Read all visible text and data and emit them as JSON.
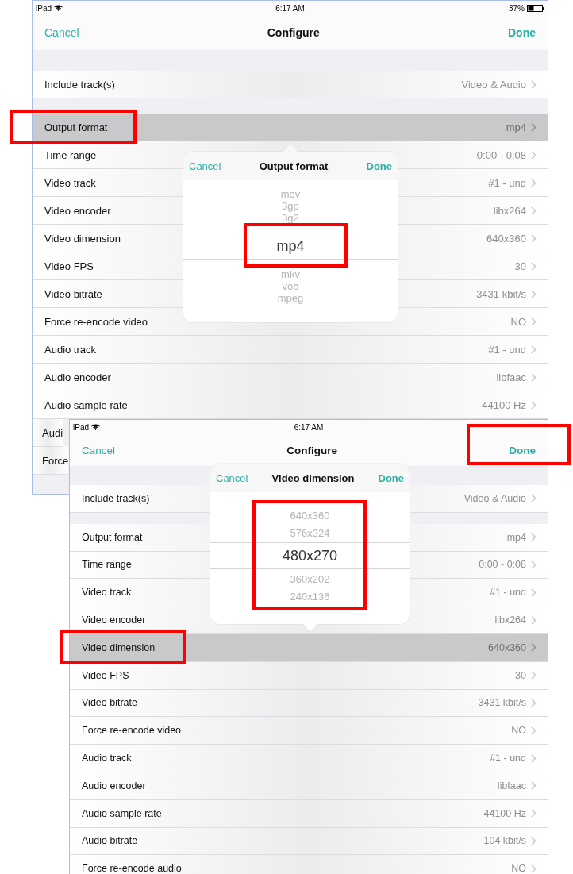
{
  "screens": [
    {
      "status_bar": {
        "carrier": "iPad",
        "time": "6:17 AM",
        "battery": "37%"
      },
      "nav": {
        "cancel": "Cancel",
        "title": "Configure",
        "done": "Done"
      },
      "groups": [
        [
          {
            "label": "Include track(s)",
            "value": "Video & Audio",
            "selected": false
          }
        ],
        [
          {
            "label": "Output format",
            "value": "mp4",
            "selected": true
          },
          {
            "label": "Time range",
            "value": "0:00 - 0:08",
            "selected": false
          },
          {
            "label": "Video track",
            "value": "#1 - und",
            "selected": false
          },
          {
            "label": "Video encoder",
            "value": "libx264",
            "selected": false
          },
          {
            "label": "Video dimension",
            "value": "640x360",
            "selected": false
          },
          {
            "label": "Video FPS",
            "value": "30",
            "selected": false
          },
          {
            "label": "Video bitrate",
            "value": "3431 kbit/s",
            "selected": false
          },
          {
            "label": "Force re-encode video",
            "value": "NO",
            "selected": false
          },
          {
            "label": "Audio track",
            "value": "#1 - und",
            "selected": false
          },
          {
            "label": "Audio encoder",
            "value": "libfaac",
            "selected": false
          },
          {
            "label": "Audio sample rate",
            "value": "44100 Hz",
            "selected": false
          },
          {
            "label": "Audi",
            "selected": false
          },
          {
            "label": "Force",
            "selected": false
          }
        ]
      ],
      "popover": {
        "cancel": "Cancel",
        "title": "Output format",
        "done": "Done",
        "options": [
          {
            "label": "mov",
            "selected": false
          },
          {
            "label": "3gp",
            "selected": false
          },
          {
            "label": "3g2",
            "selected": false
          },
          {
            "label": "mp4",
            "selected": true
          },
          {
            "label": "mkv",
            "selected": false
          },
          {
            "label": "vob",
            "selected": false
          },
          {
            "label": "mpeg",
            "selected": false
          }
        ]
      }
    },
    {
      "status_bar": {
        "carrier": "iPad",
        "time": "6:17 AM"
      },
      "nav": {
        "cancel": "Cancel",
        "title": "Configure",
        "done": "Done"
      },
      "groups": [
        [
          {
            "label": "Include track(s)",
            "value": "Video & Audio",
            "selected": false
          }
        ],
        [
          {
            "label": "Output format",
            "value": "mp4",
            "selected": false
          },
          {
            "label": "Time range",
            "value": "0:00 - 0:08",
            "selected": false
          },
          {
            "label": "Video track",
            "value": "#1 - und",
            "selected": false
          },
          {
            "label": "Video encoder",
            "value": "libx264",
            "selected": false
          },
          {
            "label": "Video dimension",
            "value": "640x360",
            "selected": true
          },
          {
            "label": "Video FPS",
            "value": "30",
            "selected": false
          },
          {
            "label": "Video bitrate",
            "value": "3431 kbit/s",
            "selected": false
          },
          {
            "label": "Force re-encode video",
            "value": "NO",
            "selected": false
          },
          {
            "label": "Audio track",
            "value": "#1 - und",
            "selected": false
          },
          {
            "label": "Audio encoder",
            "value": "libfaac",
            "selected": false
          },
          {
            "label": "Audio sample rate",
            "value": "44100 Hz",
            "selected": false
          },
          {
            "label": "Audio bitrate",
            "value": "104 kbit/s",
            "selected": false
          },
          {
            "label": "Force re-encode audio",
            "value": "NO",
            "selected": false
          }
        ]
      ],
      "popover": {
        "cancel": "Cancel",
        "title": "Video dimension",
        "done": "Done",
        "options": [
          {
            "label": "640x360",
            "selected": false
          },
          {
            "label": "576x324",
            "selected": false
          },
          {
            "label": "480x270",
            "selected": true
          },
          {
            "label": "360x202",
            "selected": false
          },
          {
            "label": "240x136",
            "selected": false
          }
        ]
      }
    }
  ]
}
